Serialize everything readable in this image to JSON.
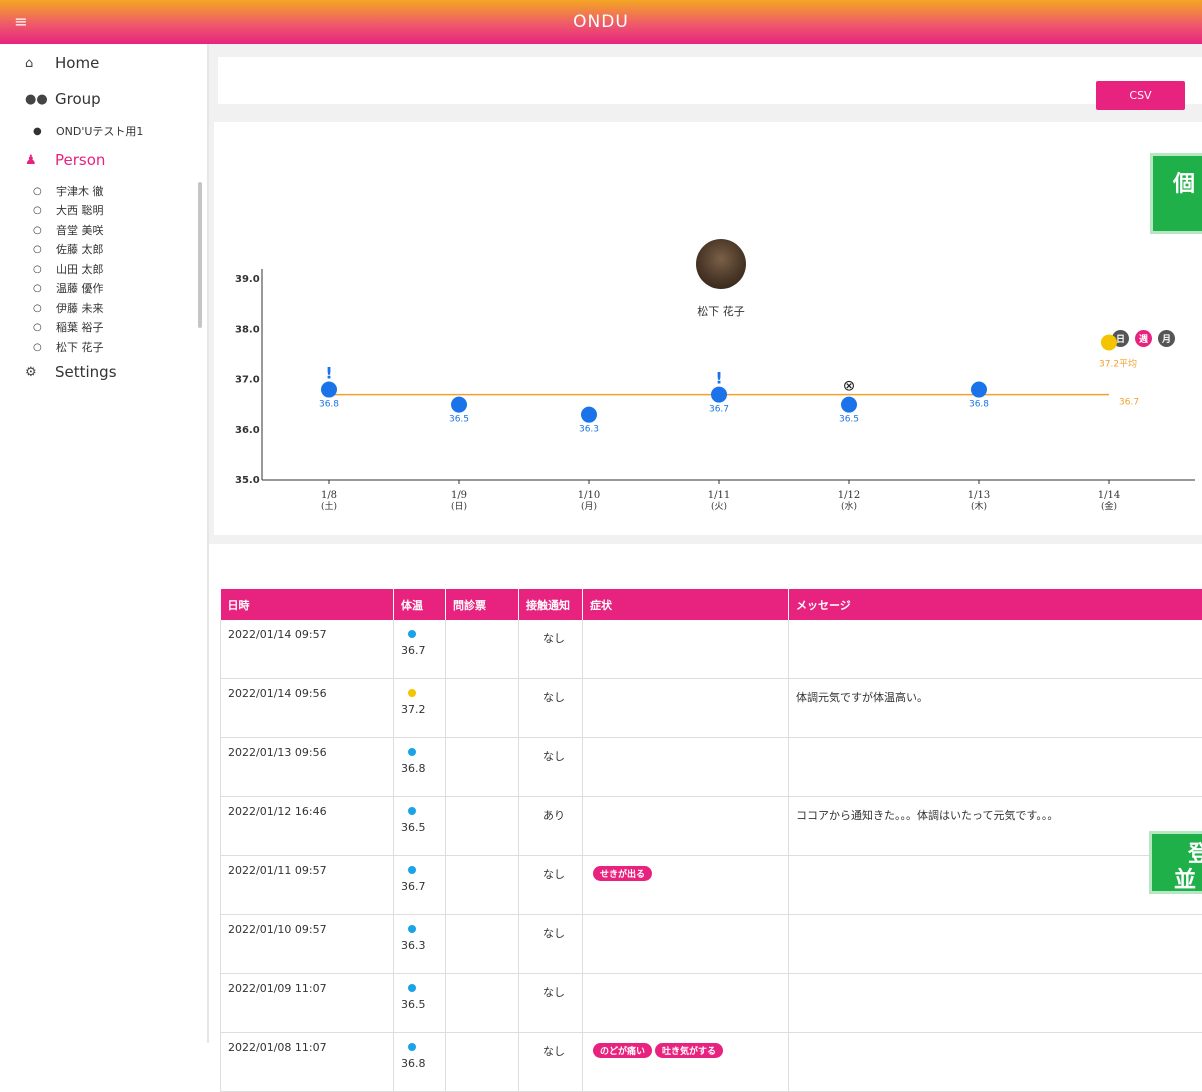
{
  "app": {
    "title": "ONDU"
  },
  "sidebar": {
    "home": "Home",
    "group": "Group",
    "group_items": [
      "OND'Uテスト用1"
    ],
    "person": "Person",
    "person_items": [
      "宇津木 徹",
      "大西 聡明",
      "音堂 美咲",
      "佐藤 太郎",
      "山田 太郎",
      "温藤 優作",
      "伊藤 未来",
      "稲葉 裕子",
      "松下 花子"
    ],
    "settings": "Settings"
  },
  "toolbar": {
    "csv_label": "CSV"
  },
  "profile": {
    "name": "松下 花子"
  },
  "period_buttons": [
    "日",
    "週",
    "月"
  ],
  "notes": {
    "top": "個",
    "bottom_line1": "登",
    "bottom_line2": "並"
  },
  "colors": {
    "accent": "#e8237f",
    "normal_dot": "#1a73e8",
    "high_dot": "#f5c400",
    "avg_line": "#f2a12e"
  },
  "chart_data": {
    "type": "scatter",
    "ylim": [
      35.0,
      39.0
    ],
    "yticks": [
      "39.0",
      "38.0",
      "37.0",
      "36.0",
      "35.0"
    ],
    "categories": [
      {
        "date": "1/8",
        "dow": "(土)"
      },
      {
        "date": "1/9",
        "dow": "(日)"
      },
      {
        "date": "1/10",
        "dow": "(月)"
      },
      {
        "date": "1/11",
        "dow": "(火)"
      },
      {
        "date": "1/12",
        "dow": "(水)"
      },
      {
        "date": "1/13",
        "dow": "(木)"
      },
      {
        "date": "1/14",
        "dow": "(金)"
      }
    ],
    "points": [
      {
        "x": "1/8",
        "y": 36.8,
        "label": "36.8",
        "color": "blue",
        "marker": "!"
      },
      {
        "x": "1/9",
        "y": 36.5,
        "label": "36.5",
        "color": "blue",
        "marker": ""
      },
      {
        "x": "1/10",
        "y": 36.3,
        "label": "36.3",
        "color": "blue",
        "marker": ""
      },
      {
        "x": "1/11",
        "y": 36.7,
        "label": "36.7",
        "color": "blue",
        "marker": "!"
      },
      {
        "x": "1/12",
        "y": 36.5,
        "label": "36.5",
        "color": "blue",
        "marker": "⊗"
      },
      {
        "x": "1/13",
        "y": 36.8,
        "label": "36.8",
        "color": "blue",
        "marker": ""
      },
      {
        "x": "1/14",
        "y": 37.2,
        "label": "37.2平均",
        "color": "yellow",
        "marker": ""
      }
    ],
    "average": {
      "value": 36.7,
      "label": "36.7"
    }
  },
  "table": {
    "headers": [
      "日時",
      "体温",
      "問診票",
      "接触通知",
      "症状",
      "メッセージ"
    ],
    "rows": [
      {
        "datetime": "2022/01/14 09:57",
        "dot": "blue",
        "temp": "36.7",
        "contact": "なし",
        "symptoms": [],
        "message": ""
      },
      {
        "datetime": "2022/01/14 09:56",
        "dot": "yellow",
        "temp": "37.2",
        "contact": "なし",
        "symptoms": [],
        "message": "体調元気ですが体温高い。"
      },
      {
        "datetime": "2022/01/13 09:56",
        "dot": "blue",
        "temp": "36.8",
        "contact": "なし",
        "symptoms": [],
        "message": ""
      },
      {
        "datetime": "2022/01/12 16:46",
        "dot": "blue",
        "temp": "36.5",
        "contact": "あり",
        "symptoms": [],
        "message": "ココアから通知きた。。。体調はいたって元気です。。。"
      },
      {
        "datetime": "2022/01/11 09:57",
        "dot": "blue",
        "temp": "36.7",
        "contact": "なし",
        "symptoms": [
          "せきが出る"
        ],
        "message": ""
      },
      {
        "datetime": "2022/01/10 09:57",
        "dot": "blue",
        "temp": "36.3",
        "contact": "なし",
        "symptoms": [],
        "message": ""
      },
      {
        "datetime": "2022/01/09 11:07",
        "dot": "blue",
        "temp": "36.5",
        "contact": "なし",
        "symptoms": [],
        "message": ""
      },
      {
        "datetime": "2022/01/08 11:07",
        "dot": "blue",
        "temp": "36.8",
        "contact": "なし",
        "symptoms": [
          "のどが痛い",
          "吐き気がする"
        ],
        "message": ""
      }
    ]
  }
}
